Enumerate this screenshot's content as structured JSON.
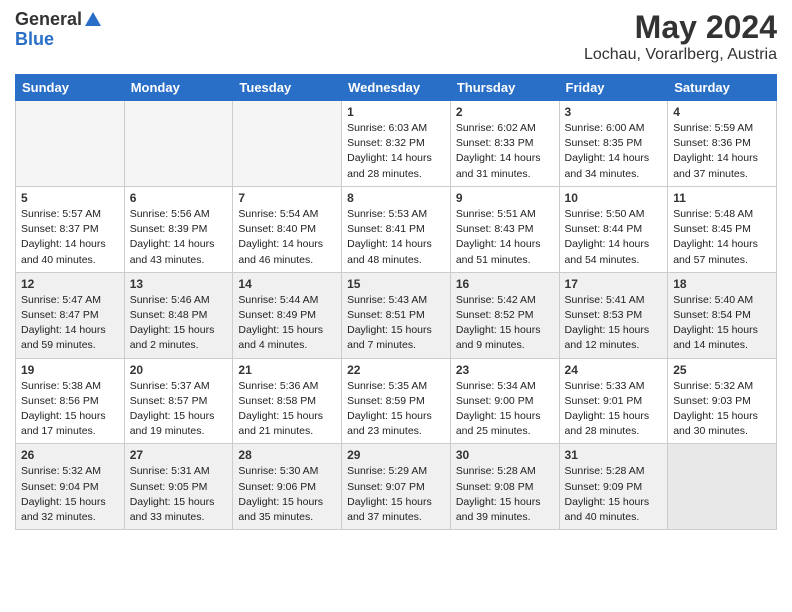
{
  "logo": {
    "general": "General",
    "blue": "Blue"
  },
  "title": {
    "month_year": "May 2024",
    "location": "Lochau, Vorarlberg, Austria"
  },
  "headers": [
    "Sunday",
    "Monday",
    "Tuesday",
    "Wednesday",
    "Thursday",
    "Friday",
    "Saturday"
  ],
  "weeks": [
    {
      "shaded": false,
      "days": [
        {
          "number": "",
          "info": ""
        },
        {
          "number": "",
          "info": ""
        },
        {
          "number": "",
          "info": ""
        },
        {
          "number": "1",
          "info": "Sunrise: 6:03 AM\nSunset: 8:32 PM\nDaylight: 14 hours\nand 28 minutes."
        },
        {
          "number": "2",
          "info": "Sunrise: 6:02 AM\nSunset: 8:33 PM\nDaylight: 14 hours\nand 31 minutes."
        },
        {
          "number": "3",
          "info": "Sunrise: 6:00 AM\nSunset: 8:35 PM\nDaylight: 14 hours\nand 34 minutes."
        },
        {
          "number": "4",
          "info": "Sunrise: 5:59 AM\nSunset: 8:36 PM\nDaylight: 14 hours\nand 37 minutes."
        }
      ]
    },
    {
      "shaded": false,
      "days": [
        {
          "number": "5",
          "info": "Sunrise: 5:57 AM\nSunset: 8:37 PM\nDaylight: 14 hours\nand 40 minutes."
        },
        {
          "number": "6",
          "info": "Sunrise: 5:56 AM\nSunset: 8:39 PM\nDaylight: 14 hours\nand 43 minutes."
        },
        {
          "number": "7",
          "info": "Sunrise: 5:54 AM\nSunset: 8:40 PM\nDaylight: 14 hours\nand 46 minutes."
        },
        {
          "number": "8",
          "info": "Sunrise: 5:53 AM\nSunset: 8:41 PM\nDaylight: 14 hours\nand 48 minutes."
        },
        {
          "number": "9",
          "info": "Sunrise: 5:51 AM\nSunset: 8:43 PM\nDaylight: 14 hours\nand 51 minutes."
        },
        {
          "number": "10",
          "info": "Sunrise: 5:50 AM\nSunset: 8:44 PM\nDaylight: 14 hours\nand 54 minutes."
        },
        {
          "number": "11",
          "info": "Sunrise: 5:48 AM\nSunset: 8:45 PM\nDaylight: 14 hours\nand 57 minutes."
        }
      ]
    },
    {
      "shaded": true,
      "days": [
        {
          "number": "12",
          "info": "Sunrise: 5:47 AM\nSunset: 8:47 PM\nDaylight: 14 hours\nand 59 minutes."
        },
        {
          "number": "13",
          "info": "Sunrise: 5:46 AM\nSunset: 8:48 PM\nDaylight: 15 hours\nand 2 minutes."
        },
        {
          "number": "14",
          "info": "Sunrise: 5:44 AM\nSunset: 8:49 PM\nDaylight: 15 hours\nand 4 minutes."
        },
        {
          "number": "15",
          "info": "Sunrise: 5:43 AM\nSunset: 8:51 PM\nDaylight: 15 hours\nand 7 minutes."
        },
        {
          "number": "16",
          "info": "Sunrise: 5:42 AM\nSunset: 8:52 PM\nDaylight: 15 hours\nand 9 minutes."
        },
        {
          "number": "17",
          "info": "Sunrise: 5:41 AM\nSunset: 8:53 PM\nDaylight: 15 hours\nand 12 minutes."
        },
        {
          "number": "18",
          "info": "Sunrise: 5:40 AM\nSunset: 8:54 PM\nDaylight: 15 hours\nand 14 minutes."
        }
      ]
    },
    {
      "shaded": false,
      "days": [
        {
          "number": "19",
          "info": "Sunrise: 5:38 AM\nSunset: 8:56 PM\nDaylight: 15 hours\nand 17 minutes."
        },
        {
          "number": "20",
          "info": "Sunrise: 5:37 AM\nSunset: 8:57 PM\nDaylight: 15 hours\nand 19 minutes."
        },
        {
          "number": "21",
          "info": "Sunrise: 5:36 AM\nSunset: 8:58 PM\nDaylight: 15 hours\nand 21 minutes."
        },
        {
          "number": "22",
          "info": "Sunrise: 5:35 AM\nSunset: 8:59 PM\nDaylight: 15 hours\nand 23 minutes."
        },
        {
          "number": "23",
          "info": "Sunrise: 5:34 AM\nSunset: 9:00 PM\nDaylight: 15 hours\nand 25 minutes."
        },
        {
          "number": "24",
          "info": "Sunrise: 5:33 AM\nSunset: 9:01 PM\nDaylight: 15 hours\nand 28 minutes."
        },
        {
          "number": "25",
          "info": "Sunrise: 5:32 AM\nSunset: 9:03 PM\nDaylight: 15 hours\nand 30 minutes."
        }
      ]
    },
    {
      "shaded": true,
      "days": [
        {
          "number": "26",
          "info": "Sunrise: 5:32 AM\nSunset: 9:04 PM\nDaylight: 15 hours\nand 32 minutes."
        },
        {
          "number": "27",
          "info": "Sunrise: 5:31 AM\nSunset: 9:05 PM\nDaylight: 15 hours\nand 33 minutes."
        },
        {
          "number": "28",
          "info": "Sunrise: 5:30 AM\nSunset: 9:06 PM\nDaylight: 15 hours\nand 35 minutes."
        },
        {
          "number": "29",
          "info": "Sunrise: 5:29 AM\nSunset: 9:07 PM\nDaylight: 15 hours\nand 37 minutes."
        },
        {
          "number": "30",
          "info": "Sunrise: 5:28 AM\nSunset: 9:08 PM\nDaylight: 15 hours\nand 39 minutes."
        },
        {
          "number": "31",
          "info": "Sunrise: 5:28 AM\nSunset: 9:09 PM\nDaylight: 15 hours\nand 40 minutes."
        },
        {
          "number": "",
          "info": ""
        }
      ]
    }
  ]
}
